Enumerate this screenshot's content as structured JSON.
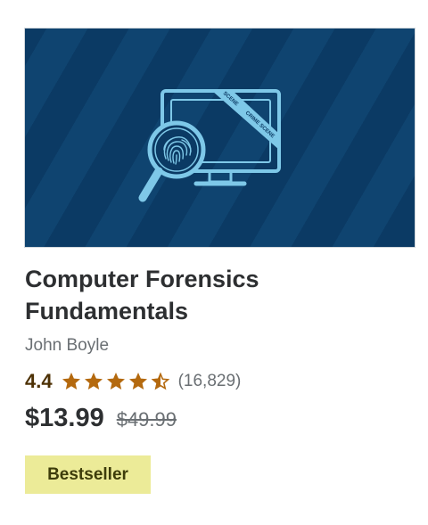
{
  "course": {
    "title": "Computer Forensics Fundamentals",
    "instructor": "John Boyle",
    "rating": "4.4",
    "rating_stars": 4.4,
    "rating_count": "(16,829)",
    "price": "$13.99",
    "original_price": "$49.99",
    "badge": "Bestseller"
  },
  "thumbnail": {
    "tape_text_1": "SCENE",
    "tape_text_2": "CRIME SCENE",
    "icon": "computer-forensics-illustration"
  },
  "colors": {
    "thumb_bg": "#0b3a64",
    "illustration": "#7ec8e8",
    "star": "#b4690e",
    "badge_bg": "#eceb98"
  }
}
